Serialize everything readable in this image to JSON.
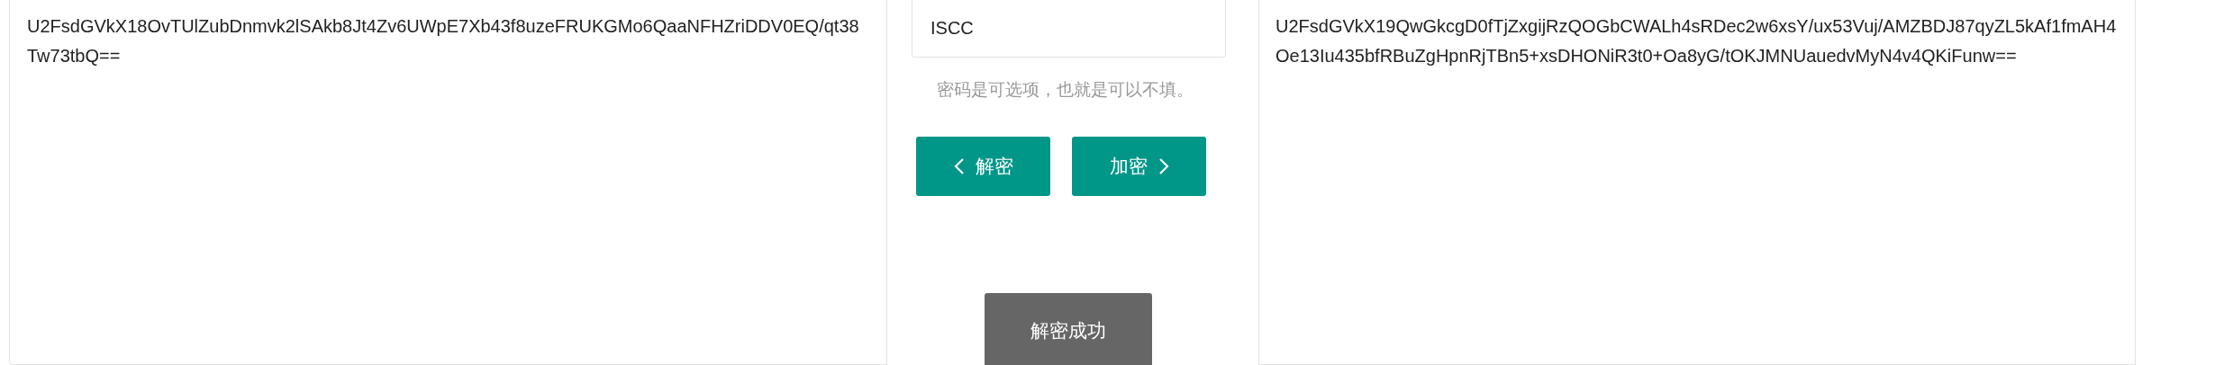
{
  "input_text": {
    "value": "U2FsdGVkX18OvTUlZubDnmvk2lSAkb8Jt4Zv6UWpE7Xb43f8uzeFRUKGMo6QaaNFHZriDDV0EQ/qt38Tw73tbQ=="
  },
  "password": {
    "value": "ISCC"
  },
  "hint": "密码是可选项，也就是可以不填。",
  "buttons": [
    {
      "label": "解密",
      "kind": "decrypt"
    },
    {
      "label": "加密",
      "kind": "encrypt"
    }
  ],
  "status": "解密成功",
  "output_text": {
    "value": "U2FsdGVkX19QwGkcgD0fTjZxgijRzQOGbCWALh4sRDec2w6xsY/ux53Vuj/AMZBDJ87qyZL5kAf1fmAH4Oe13Iu435bfRBuZgHpnRjTBn5+xsDHONiR3t0+Oa8yG/tOKJMNUauedvMyN4v4QKiFunw=="
  }
}
